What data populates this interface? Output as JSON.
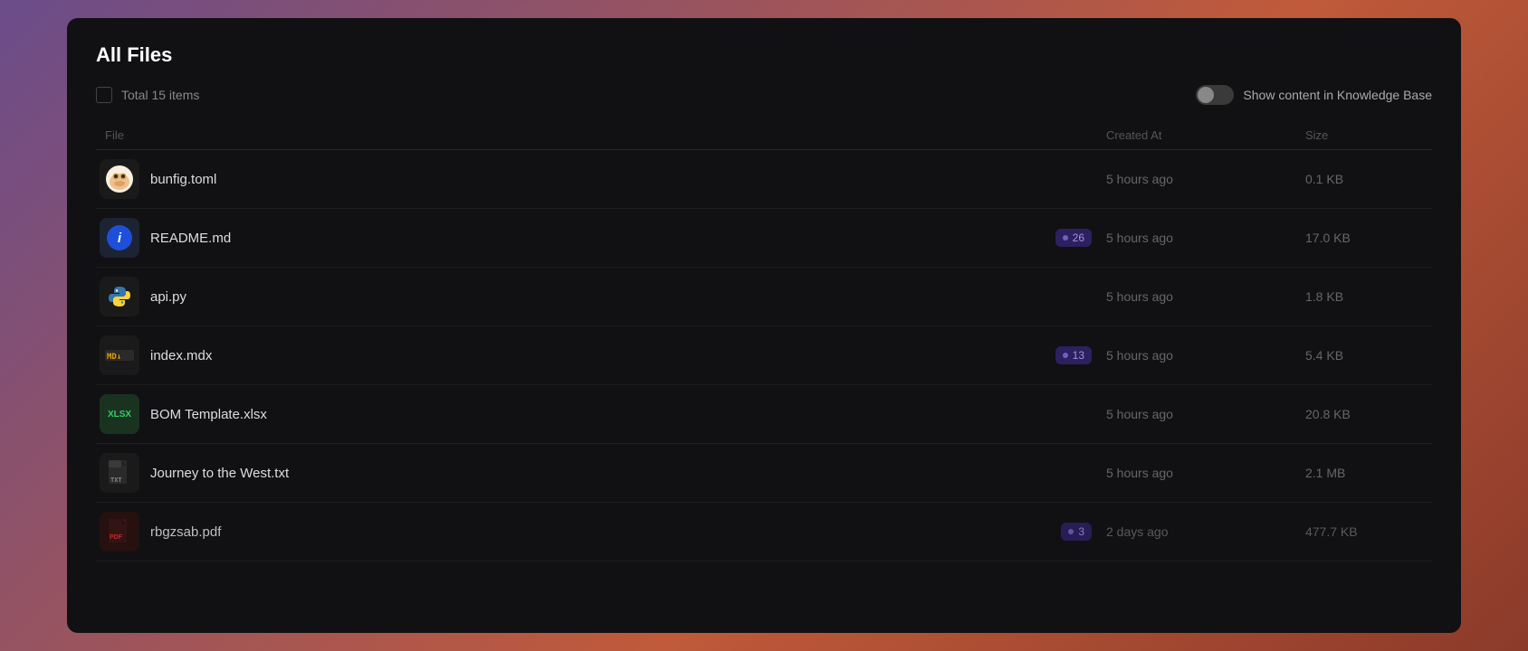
{
  "panel": {
    "title": "All Files",
    "total_label": "Total 15 items"
  },
  "toggle": {
    "label": "Show content in Knowledge Base",
    "enabled": false
  },
  "table": {
    "headers": {
      "file": "File",
      "created_at": "Created At",
      "size": "Size"
    },
    "rows": [
      {
        "id": "bunfig",
        "name": "bunfig.toml",
        "icon_type": "bun",
        "created_at": "5 hours ago",
        "size": "0.1 KB",
        "badge": null
      },
      {
        "id": "readme",
        "name": "README.md",
        "icon_type": "readme",
        "created_at": "5 hours ago",
        "size": "17.0 KB",
        "badge": "26"
      },
      {
        "id": "api",
        "name": "api.py",
        "icon_type": "python",
        "created_at": "5 hours ago",
        "size": "1.8 KB",
        "badge": null
      },
      {
        "id": "index",
        "name": "index.mdx",
        "icon_type": "mdx",
        "created_at": "5 hours ago",
        "size": "5.4 KB",
        "badge": "13"
      },
      {
        "id": "bom",
        "name": "BOM Template.xlsx",
        "icon_type": "xlsx",
        "created_at": "5 hours ago",
        "size": "20.8 KB",
        "badge": null
      },
      {
        "id": "journey",
        "name": "Journey to the West.txt",
        "icon_type": "txt",
        "created_at": "5 hours ago",
        "size": "2.1 MB",
        "badge": null
      },
      {
        "id": "rbgzsab",
        "name": "rbgzsab.pdf",
        "icon_type": "pdf",
        "created_at": "2 days ago",
        "size": "477.7 KB",
        "badge": "3"
      }
    ]
  }
}
